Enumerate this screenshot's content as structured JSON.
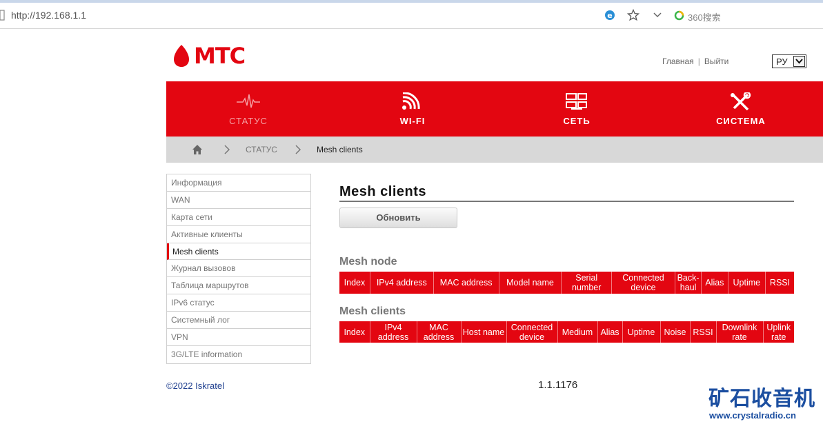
{
  "browser": {
    "url": "http://192.168.1.1",
    "search_engine": "360搜索"
  },
  "header": {
    "logo_text": "МТС",
    "home_link": "Главная",
    "separator": "|",
    "logout_link": "Выйти",
    "language": "РУ"
  },
  "nav": {
    "items": [
      {
        "label": "СТАТУС",
        "icon": "pulse-icon"
      },
      {
        "label": "WI-FI",
        "icon": "wifi-icon"
      },
      {
        "label": "СЕТЬ",
        "icon": "network-icon"
      },
      {
        "label": "СИСТЕМА",
        "icon": "tools-icon"
      }
    ]
  },
  "breadcrumb": {
    "section": "СТАТУС",
    "page": "Mesh clients"
  },
  "sidebar": {
    "items": [
      "Информация",
      "WAN",
      "Карта сети",
      "Активные клиенты",
      "Mesh clients",
      "Журнал вызовов",
      "Таблица маршрутов",
      "IPv6 статус",
      "Системный лог",
      "VPN",
      "3G/LTE information"
    ],
    "active_index": 4
  },
  "main": {
    "title": "Mesh clients",
    "refresh_label": "Обновить",
    "node_section": {
      "title": "Mesh node",
      "columns": [
        "Index",
        "IPv4 address",
        "MAC address",
        "Model name",
        "Serial number",
        "Connected device",
        "Back-haul",
        "Alias",
        "Uptime",
        "RSSI"
      ]
    },
    "clients_section": {
      "title": "Mesh clients",
      "columns": [
        "Index",
        "IPv4 address",
        "MAC address",
        "Host name",
        "Connected device",
        "Medium",
        "Alias",
        "Uptime",
        "Noise",
        "RSSI",
        "Downlink rate",
        "Uplink rate"
      ]
    }
  },
  "footer": {
    "copyright": "©2022 Iskratel",
    "version": "1.1.1176"
  },
  "watermark": {
    "title": "矿石收音机",
    "url": "www.crystalradio.cn"
  },
  "colors": {
    "brand_red": "#e30611",
    "breadcrumb_gray": "#d8d8d8",
    "watermark_blue": "#1b4ea0"
  }
}
